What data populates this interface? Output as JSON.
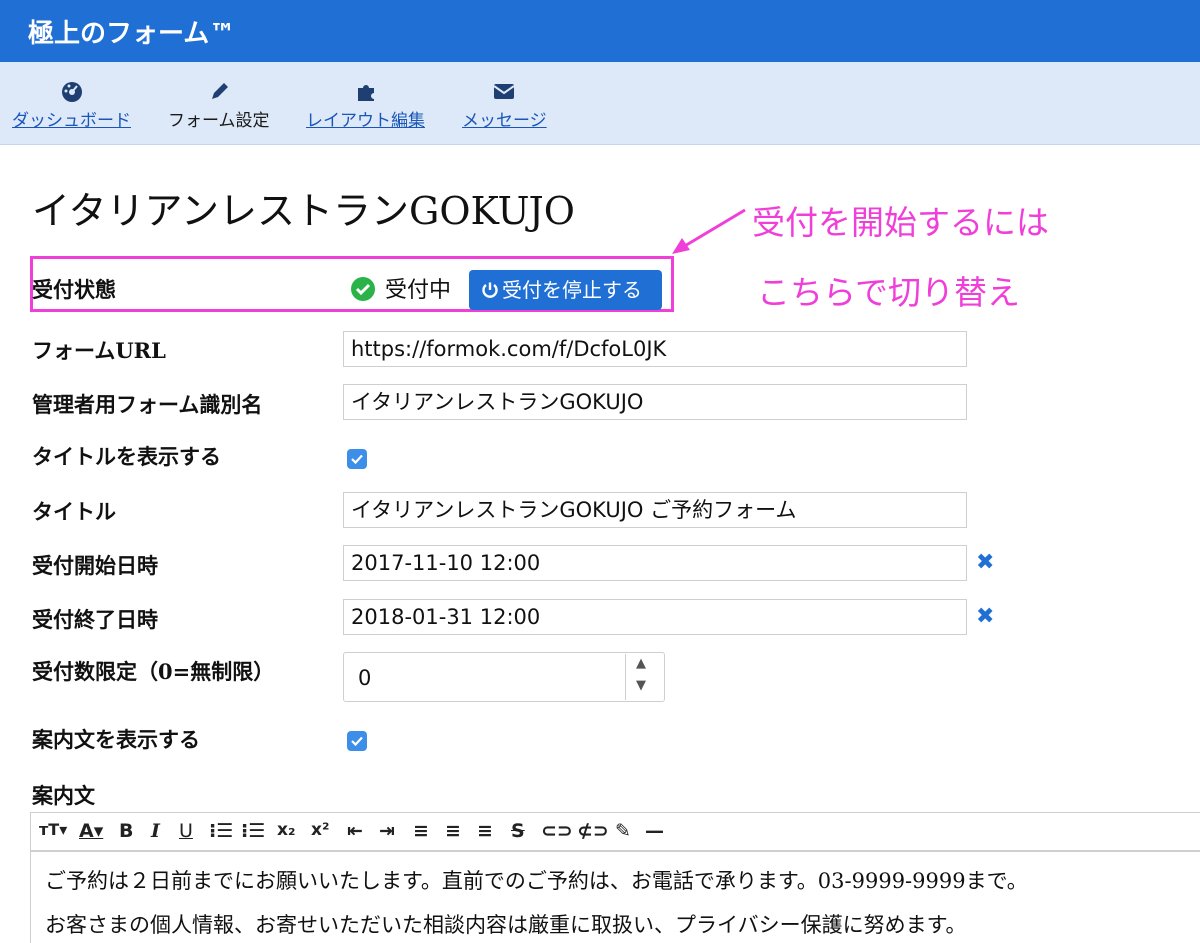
{
  "app": {
    "title": "極上のフォーム™"
  },
  "nav": [
    {
      "label": "ダッシュボード",
      "icon": "dashboard-icon",
      "active": false
    },
    {
      "label": "フォーム設定",
      "icon": "pencil-icon",
      "active": true
    },
    {
      "label": "レイアウト編集",
      "icon": "puzzle-icon",
      "active": false
    },
    {
      "label": "メッセージ",
      "icon": "envelope-icon",
      "active": false
    }
  ],
  "page": {
    "title": "イタリアンレストランGOKUJO"
  },
  "callout": {
    "line1": "受付を開始するには",
    "line2": "こちらで切り替え",
    "color": "#ef3fd8"
  },
  "form": {
    "status": {
      "label": "受付状態",
      "value": "受付中",
      "button": "受付を停止する"
    },
    "form_url": {
      "label": "フォームURL",
      "value": "https://formok.com/f/DcfoL0JK"
    },
    "admin_name": {
      "label": "管理者用フォーム識別名",
      "value": "イタリアンレストランGOKUJO"
    },
    "show_title": {
      "label": "タイトルを表示する",
      "checked": true
    },
    "title": {
      "label": "タイトル",
      "value": "イタリアンレストランGOKUJO ご予約フォーム"
    },
    "start": {
      "label": "受付開始日時",
      "value": "2017-11-10 12:00"
    },
    "end": {
      "label": "受付終了日時",
      "value": "2018-01-31 12:00"
    },
    "limit": {
      "label": "受付数限定（0=無制限）",
      "value": "0"
    },
    "show_intro": {
      "label": "案内文を表示する",
      "checked": true
    },
    "intro": {
      "label": "案内文",
      "lines": [
        "ご予約は２日前までにお願いいたします。直前でのご予約は、お電話で承ります。03-9999-9999まで。",
        "お客さまの個人情報、お寄せいただいた相談内容は厳重に取扱い、プライバシー保護に努めます。"
      ]
    }
  },
  "colors": {
    "primary": "#1f6fd4",
    "nav_bg": "#dde9f8",
    "success": "#2bb34a"
  }
}
